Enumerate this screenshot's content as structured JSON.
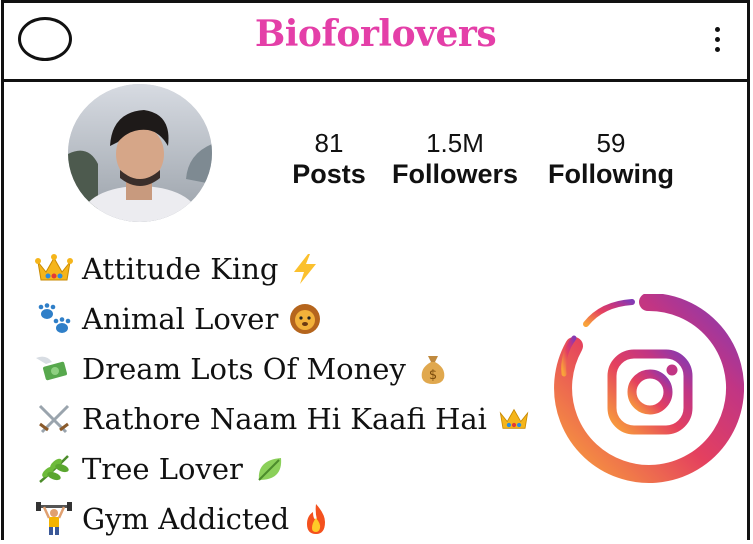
{
  "header": {
    "brand": "Bioforlovers",
    "brand_color": "#e43fa8",
    "menu_icon": "kebab-menu-icon"
  },
  "profile": {
    "stats": [
      {
        "value": "81",
        "label": "Posts"
      },
      {
        "value": "1.5M",
        "label": "Followers"
      },
      {
        "value": "59",
        "label": "Following"
      }
    ]
  },
  "bio": {
    "lines": [
      {
        "emoji": "crown",
        "text": "Attitude King",
        "trail": "lightning"
      },
      {
        "emoji": "paw-prints",
        "text": "Animal Lover",
        "trail": "lion"
      },
      {
        "emoji": "money-with-wings",
        "text": "Dream Lots Of Money",
        "trail": "money-bag"
      },
      {
        "emoji": "crossed-swords",
        "text": "Rathore Naam Hi Kaafi Hai",
        "trail": "crown"
      },
      {
        "emoji": "herb",
        "text": "Tree Lover",
        "trail": "leaf"
      },
      {
        "emoji": "weight-lifter",
        "text": "Gym Addicted",
        "trail": "fire"
      }
    ]
  },
  "logo": {
    "icon": "instagram-logo-icon",
    "colors": [
      "#f9a33a",
      "#e4405f",
      "#c13584",
      "#833ab4"
    ]
  }
}
